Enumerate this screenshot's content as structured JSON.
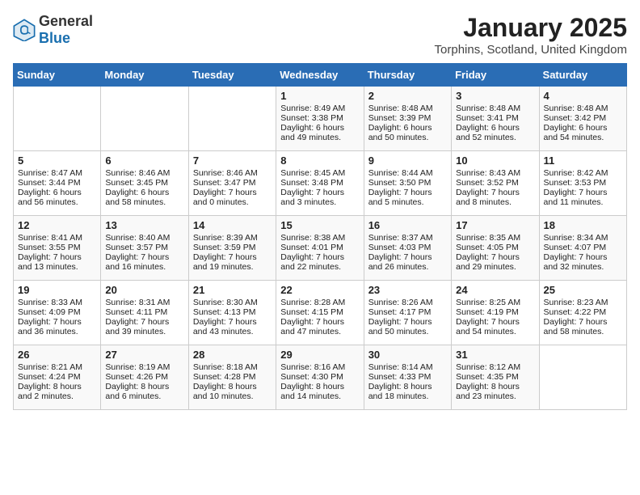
{
  "header": {
    "logo_general": "General",
    "logo_blue": "Blue",
    "month": "January 2025",
    "location": "Torphins, Scotland, United Kingdom"
  },
  "days_of_week": [
    "Sunday",
    "Monday",
    "Tuesday",
    "Wednesday",
    "Thursday",
    "Friday",
    "Saturday"
  ],
  "weeks": [
    [
      {
        "day": "",
        "data": ""
      },
      {
        "day": "",
        "data": ""
      },
      {
        "day": "",
        "data": ""
      },
      {
        "day": "1",
        "data": "Sunrise: 8:49 AM\nSunset: 3:38 PM\nDaylight: 6 hours\nand 49 minutes."
      },
      {
        "day": "2",
        "data": "Sunrise: 8:48 AM\nSunset: 3:39 PM\nDaylight: 6 hours\nand 50 minutes."
      },
      {
        "day": "3",
        "data": "Sunrise: 8:48 AM\nSunset: 3:41 PM\nDaylight: 6 hours\nand 52 minutes."
      },
      {
        "day": "4",
        "data": "Sunrise: 8:48 AM\nSunset: 3:42 PM\nDaylight: 6 hours\nand 54 minutes."
      }
    ],
    [
      {
        "day": "5",
        "data": "Sunrise: 8:47 AM\nSunset: 3:44 PM\nDaylight: 6 hours\nand 56 minutes."
      },
      {
        "day": "6",
        "data": "Sunrise: 8:46 AM\nSunset: 3:45 PM\nDaylight: 6 hours\nand 58 minutes."
      },
      {
        "day": "7",
        "data": "Sunrise: 8:46 AM\nSunset: 3:47 PM\nDaylight: 7 hours\nand 0 minutes."
      },
      {
        "day": "8",
        "data": "Sunrise: 8:45 AM\nSunset: 3:48 PM\nDaylight: 7 hours\nand 3 minutes."
      },
      {
        "day": "9",
        "data": "Sunrise: 8:44 AM\nSunset: 3:50 PM\nDaylight: 7 hours\nand 5 minutes."
      },
      {
        "day": "10",
        "data": "Sunrise: 8:43 AM\nSunset: 3:52 PM\nDaylight: 7 hours\nand 8 minutes."
      },
      {
        "day": "11",
        "data": "Sunrise: 8:42 AM\nSunset: 3:53 PM\nDaylight: 7 hours\nand 11 minutes."
      }
    ],
    [
      {
        "day": "12",
        "data": "Sunrise: 8:41 AM\nSunset: 3:55 PM\nDaylight: 7 hours\nand 13 minutes."
      },
      {
        "day": "13",
        "data": "Sunrise: 8:40 AM\nSunset: 3:57 PM\nDaylight: 7 hours\nand 16 minutes."
      },
      {
        "day": "14",
        "data": "Sunrise: 8:39 AM\nSunset: 3:59 PM\nDaylight: 7 hours\nand 19 minutes."
      },
      {
        "day": "15",
        "data": "Sunrise: 8:38 AM\nSunset: 4:01 PM\nDaylight: 7 hours\nand 22 minutes."
      },
      {
        "day": "16",
        "data": "Sunrise: 8:37 AM\nSunset: 4:03 PM\nDaylight: 7 hours\nand 26 minutes."
      },
      {
        "day": "17",
        "data": "Sunrise: 8:35 AM\nSunset: 4:05 PM\nDaylight: 7 hours\nand 29 minutes."
      },
      {
        "day": "18",
        "data": "Sunrise: 8:34 AM\nSunset: 4:07 PM\nDaylight: 7 hours\nand 32 minutes."
      }
    ],
    [
      {
        "day": "19",
        "data": "Sunrise: 8:33 AM\nSunset: 4:09 PM\nDaylight: 7 hours\nand 36 minutes."
      },
      {
        "day": "20",
        "data": "Sunrise: 8:31 AM\nSunset: 4:11 PM\nDaylight: 7 hours\nand 39 minutes."
      },
      {
        "day": "21",
        "data": "Sunrise: 8:30 AM\nSunset: 4:13 PM\nDaylight: 7 hours\nand 43 minutes."
      },
      {
        "day": "22",
        "data": "Sunrise: 8:28 AM\nSunset: 4:15 PM\nDaylight: 7 hours\nand 47 minutes."
      },
      {
        "day": "23",
        "data": "Sunrise: 8:26 AM\nSunset: 4:17 PM\nDaylight: 7 hours\nand 50 minutes."
      },
      {
        "day": "24",
        "data": "Sunrise: 8:25 AM\nSunset: 4:19 PM\nDaylight: 7 hours\nand 54 minutes."
      },
      {
        "day": "25",
        "data": "Sunrise: 8:23 AM\nSunset: 4:22 PM\nDaylight: 7 hours\nand 58 minutes."
      }
    ],
    [
      {
        "day": "26",
        "data": "Sunrise: 8:21 AM\nSunset: 4:24 PM\nDaylight: 8 hours\nand 2 minutes."
      },
      {
        "day": "27",
        "data": "Sunrise: 8:19 AM\nSunset: 4:26 PM\nDaylight: 8 hours\nand 6 minutes."
      },
      {
        "day": "28",
        "data": "Sunrise: 8:18 AM\nSunset: 4:28 PM\nDaylight: 8 hours\nand 10 minutes."
      },
      {
        "day": "29",
        "data": "Sunrise: 8:16 AM\nSunset: 4:30 PM\nDaylight: 8 hours\nand 14 minutes."
      },
      {
        "day": "30",
        "data": "Sunrise: 8:14 AM\nSunset: 4:33 PM\nDaylight: 8 hours\nand 18 minutes."
      },
      {
        "day": "31",
        "data": "Sunrise: 8:12 AM\nSunset: 4:35 PM\nDaylight: 8 hours\nand 23 minutes."
      },
      {
        "day": "",
        "data": ""
      }
    ]
  ]
}
